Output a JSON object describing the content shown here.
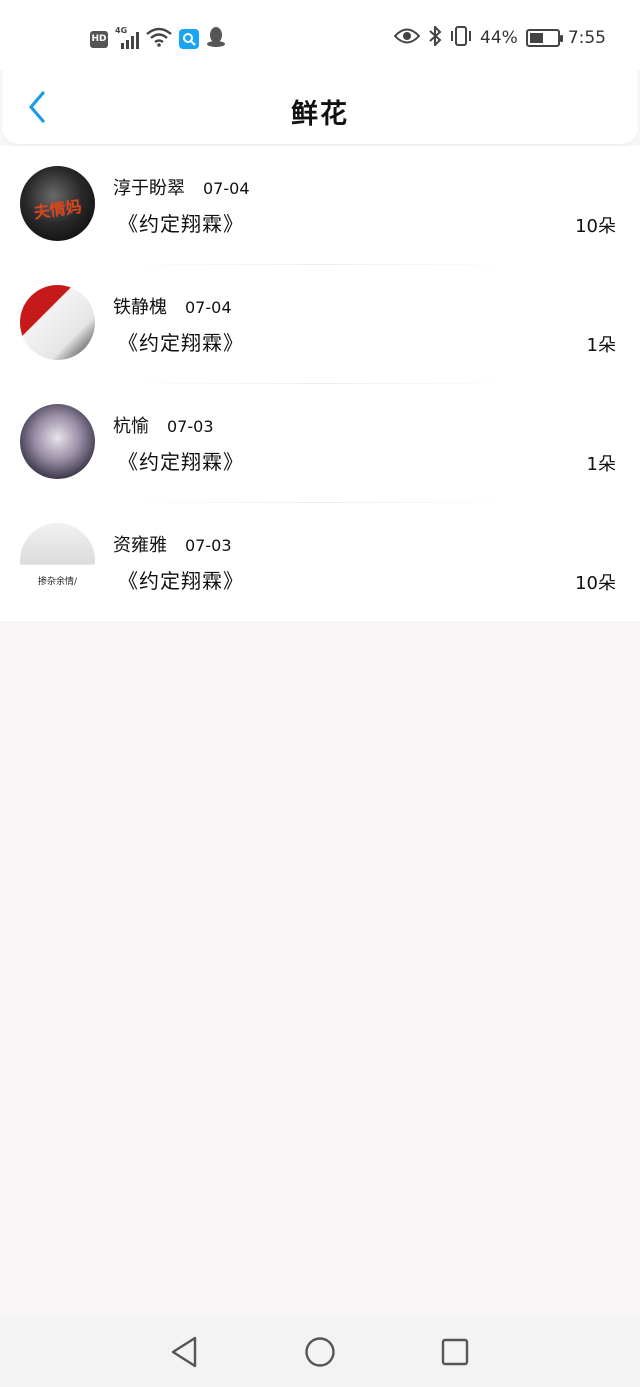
{
  "status_bar": {
    "hd": "HD",
    "network": "4G",
    "battery_percent": "44%",
    "time": "7:55",
    "icons": [
      "hd-icon",
      "signal-icon",
      "wifi-icon",
      "search-app-icon",
      "qq-icon",
      "eye-icon",
      "bluetooth-icon",
      "vibrate-icon",
      "battery-icon"
    ]
  },
  "header": {
    "title": "鲜花",
    "back_icon": "chevron-left-icon",
    "accent": "#1a9be6"
  },
  "records": [
    {
      "name": "淳于盼翠",
      "date": "07-04",
      "gift": "《约定翔霖》",
      "count": "10朵",
      "avatar_text": "夫情妈"
    },
    {
      "name": "铁静槐",
      "date": "07-04",
      "gift": "《约定翔霖》",
      "count": "1朵"
    },
    {
      "name": "杭愉",
      "date": "07-03",
      "gift": "《约定翔霖》",
      "count": "1朵"
    },
    {
      "name": "资雍雅",
      "date": "07-03",
      "gift": "《约定翔霖》",
      "count": "10朵",
      "avatar_text": "掺杂余情/"
    }
  ],
  "nav": {
    "icons": [
      "back-triangle-icon",
      "home-circle-icon",
      "recents-square-icon"
    ]
  }
}
